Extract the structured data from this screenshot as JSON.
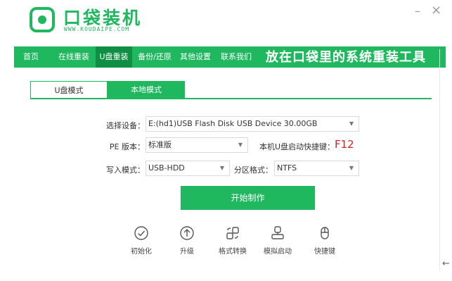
{
  "app": {
    "title": "口袋装机",
    "url": "WWW.KOUDAIPE.COM",
    "minimize_glyph": "–",
    "close_glyph": "×"
  },
  "nav": {
    "items": [
      {
        "label": "首页",
        "active": false
      },
      {
        "label": "在线重装",
        "active": false
      },
      {
        "label": "U盘重装",
        "active": true
      },
      {
        "label": "备份/还原",
        "active": false
      },
      {
        "label": "其他设置",
        "active": false
      },
      {
        "label": "联系我们",
        "active": false
      }
    ],
    "slogan": "放在口袋里的系统重装工具"
  },
  "tabs": [
    {
      "label": "U盘模式",
      "active": true
    },
    {
      "label": "本地模式",
      "active": false
    }
  ],
  "form": {
    "device": {
      "label": "选择设备：",
      "value": "E:(hd1)USB Flash Disk USB Device 30.00GB"
    },
    "pe_version": {
      "label": "PE 版本：",
      "value": "标准版"
    },
    "hotkey": {
      "label": "本机U盘启动快捷键：",
      "value": "F12"
    },
    "write_mode": {
      "label": "写入模式：",
      "value": "USB-HDD"
    },
    "partition_format": {
      "label": "分区格式：",
      "value": "NTFS"
    }
  },
  "start_button": "开始制作",
  "tools": [
    {
      "label": "初始化",
      "icon": "check-circle-icon"
    },
    {
      "label": "升级",
      "icon": "upgrade-arrow-icon"
    },
    {
      "label": "格式转换",
      "icon": "format-convert-icon"
    },
    {
      "label": "模拟启动",
      "icon": "simulate-boot-icon"
    },
    {
      "label": "快捷键",
      "icon": "mouse-icon"
    }
  ],
  "footer": {
    "back_glyph": "←"
  },
  "colors": {
    "accent": "#1fb85f",
    "accent_dark": "#0e8f43",
    "hotkey": "#e02020"
  }
}
